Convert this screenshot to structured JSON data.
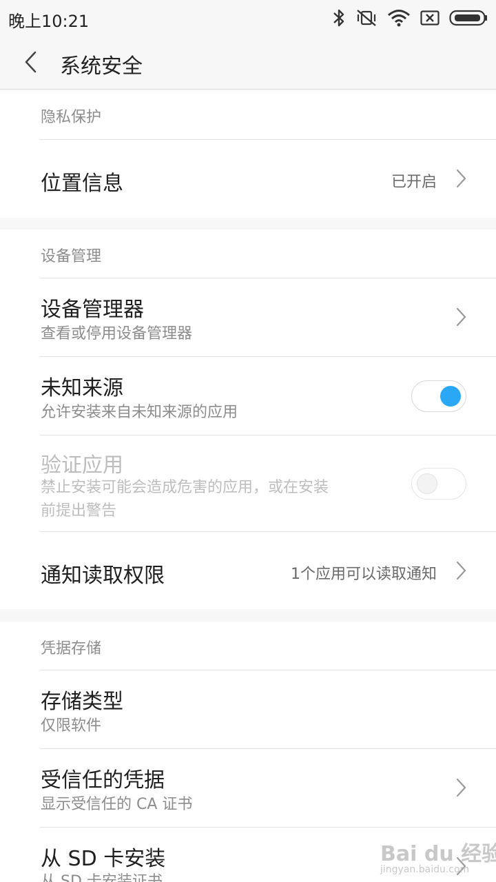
{
  "status_bar": {
    "time": "晚上10:21",
    "icons": [
      "bluetooth-icon",
      "mute-vibrate-icon",
      "wifi-icon",
      "no-sim-icon",
      "battery-icon"
    ]
  },
  "header": {
    "back_icon": "chevron-left-icon",
    "title": "系统安全"
  },
  "sections": {
    "privacy": {
      "header": "隐私保护",
      "location": {
        "title": "位置信息",
        "value": "已开启"
      }
    },
    "device": {
      "header": "设备管理",
      "device_admin": {
        "title": "设备管理器",
        "subtitle": "查看或停用设备管理器"
      },
      "unknown_sources": {
        "title": "未知来源",
        "subtitle": "允许安装来自未知来源的应用",
        "toggle": "on"
      },
      "verify_apps": {
        "title": "验证应用",
        "subtitle_line1": "禁止安装可能会造成危害的应用，或在安装",
        "subtitle_line2": "前提出警告",
        "toggle": "off",
        "disabled": true
      },
      "notification_access": {
        "title": "通知读取权限",
        "value": "1个应用可以读取通知"
      }
    },
    "credentials": {
      "header": "凭据存储",
      "storage_type": {
        "title": "存储类型",
        "subtitle": "仅限软件"
      },
      "trusted_credentials": {
        "title": "受信任的凭据",
        "subtitle": "显示受信任的 CA 证书"
      },
      "install_from_sd": {
        "title": "从 SD 卡安装",
        "subtitle": "从 SD 卡安装证书"
      }
    }
  },
  "colors": {
    "accent": "#2aa8f6",
    "background": "#f7f7f7",
    "card": "#ffffff",
    "secondary_text": "#8c8c8c"
  },
  "watermark": {
    "text": "Bai du 经验",
    "sub": "jingyan.baidu.com"
  }
}
